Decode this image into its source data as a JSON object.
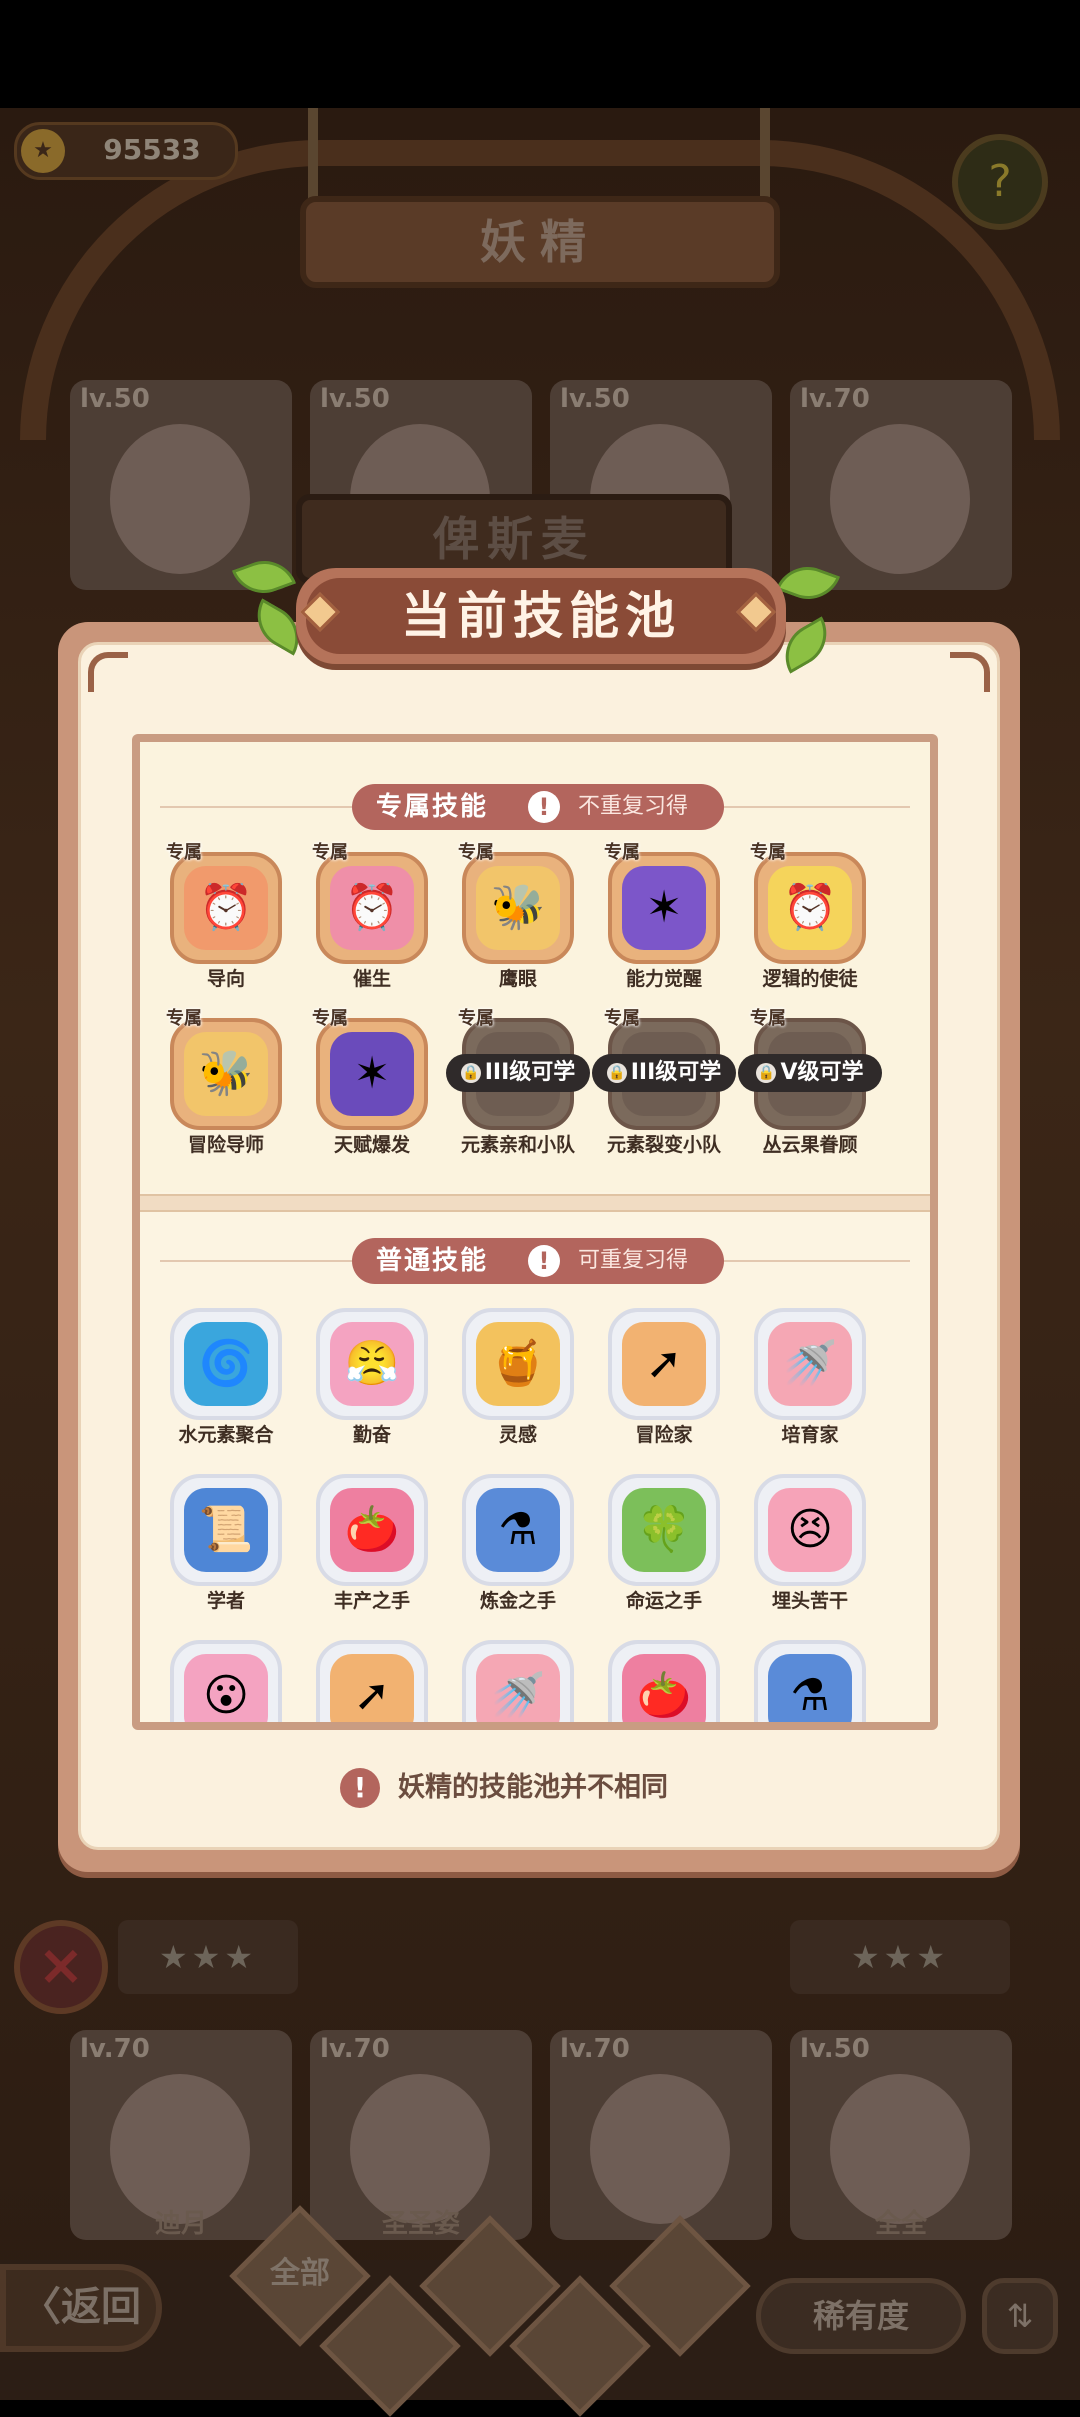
{
  "background": {
    "coins": "95533",
    "screen_title": "妖精",
    "cards_top": [
      {
        "lv": "lv.50"
      },
      {
        "lv": "lv.50"
      },
      {
        "lv": "lv.50"
      },
      {
        "lv": "lv.70"
      }
    ],
    "fairy_name": "俾斯麦",
    "cards_bottom": [
      {
        "lv": "lv.70",
        "name": "迪月"
      },
      {
        "lv": "lv.70",
        "name": "圣圣姿"
      },
      {
        "lv": "lv.70",
        "name": ""
      },
      {
        "lv": "lv.50",
        "name": "全全"
      }
    ],
    "back_label": "〈返回",
    "tab_all": "全部",
    "rarity_label": "稀有度",
    "stars": "★★★"
  },
  "dialog": {
    "title": "当前技能池",
    "exclusive": {
      "label": "专属技能",
      "note": "不重复习得",
      "skills": [
        {
          "tag": "专属",
          "name": "导向",
          "icon": "alarm-clock-icon",
          "glyph": "⏰",
          "color": "#f19a6c"
        },
        {
          "tag": "专属",
          "name": "催生",
          "icon": "alarm-clock-icon",
          "glyph": "⏰",
          "color": "#ef8fa8"
        },
        {
          "tag": "专属",
          "name": "鹰眼",
          "icon": "bee-icon",
          "glyph": "🐝",
          "color": "#f2c56a"
        },
        {
          "tag": "专属",
          "name": "能力觉醒",
          "icon": "dancer-icon",
          "glyph": "✶",
          "color": "#7c56c9"
        },
        {
          "tag": "专属",
          "name": "逻辑的使徒",
          "icon": "alarm-clock-icon",
          "glyph": "⏰",
          "color": "#f5d45b"
        },
        {
          "tag": "专属",
          "name": "冒险导师",
          "icon": "bee-icon",
          "glyph": "🐝",
          "color": "#f2c56a"
        },
        {
          "tag": "专属",
          "name": "天赋爆发",
          "icon": "dancer-icon",
          "glyph": "✶",
          "color": "#6a4bbb"
        },
        {
          "tag": "专属",
          "name": "元素亲和小队",
          "icon": "locked-skill-icon",
          "glyph": "",
          "color": "#6e5d52",
          "lock": "III级可学"
        },
        {
          "tag": "专属",
          "name": "元素裂变小队",
          "icon": "locked-skill-icon",
          "glyph": "",
          "color": "#6e5d52",
          "lock": "III级可学"
        },
        {
          "tag": "专属",
          "name": "丛云果眷顾",
          "icon": "locked-skill-icon",
          "glyph": "",
          "color": "#6e5d52",
          "lock": "V级可学"
        }
      ]
    },
    "normal": {
      "label": "普通技能",
      "note": "可重复习得",
      "skills": [
        {
          "name": "水元素聚合",
          "icon": "water-swirl-icon",
          "glyph": "🌀",
          "color": "#3aa6dd"
        },
        {
          "name": "勤奋",
          "icon": "angry-face-icon",
          "glyph": "😤",
          "color": "#f4a3c1"
        },
        {
          "name": "灵感",
          "icon": "pot-icon",
          "glyph": "🍯",
          "color": "#f3c25d"
        },
        {
          "name": "冒险家",
          "icon": "treasure-sack-icon",
          "glyph": "➚",
          "color": "#f2b271"
        },
        {
          "name": "培育家",
          "icon": "watering-can-icon",
          "glyph": "🚿",
          "color": "#f5a7b4"
        },
        {
          "name": "学者",
          "icon": "scroll-icon",
          "glyph": "📜",
          "color": "#4e86d6"
        },
        {
          "name": "丰产之手",
          "icon": "tomato-icon",
          "glyph": "🍅",
          "color": "#ee7fa0"
        },
        {
          "name": "炼金之手",
          "icon": "cauldron-icon",
          "glyph": "⚗",
          "color": "#5a8bd8"
        },
        {
          "name": "命运之手",
          "icon": "clover-icon",
          "glyph": "🍀",
          "color": "#7cbf5a"
        },
        {
          "name": "埋头苦干",
          "icon": "angry-face-icon",
          "glyph": "😣",
          "color": "#f6a3b8"
        },
        {
          "name": "",
          "icon": "surprised-face-icon",
          "glyph": "😮",
          "color": "#f4a3c1"
        },
        {
          "name": "",
          "icon": "treasure-sack-icon",
          "glyph": "➚",
          "color": "#f2b271"
        },
        {
          "name": "",
          "icon": "watering-can-icon",
          "glyph": "🚿",
          "color": "#f5a7b4"
        },
        {
          "name": "",
          "icon": "tomato-icon",
          "glyph": "🍅",
          "color": "#ee7fa0"
        },
        {
          "name": "",
          "icon": "cauldron-icon",
          "glyph": "⚗",
          "color": "#5a8bd8"
        }
      ]
    },
    "tip": "妖精的技能池并不相同"
  }
}
